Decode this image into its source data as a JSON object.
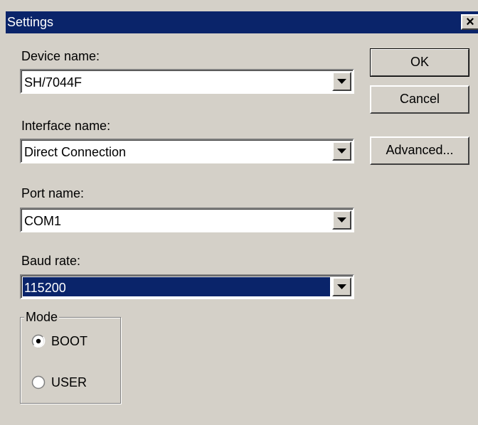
{
  "window": {
    "title": "Settings",
    "close_glyph": "×"
  },
  "fields": {
    "device": {
      "label": "Device name:",
      "value": "SH/7044F"
    },
    "interface": {
      "label": "Interface name:",
      "value": "Direct Connection"
    },
    "port": {
      "label": "Port name:",
      "value": "COM1"
    },
    "baud": {
      "label": "Baud rate:",
      "value": "115200"
    }
  },
  "buttons": {
    "ok": "OK",
    "cancel": "Cancel",
    "advanced": "Advanced..."
  },
  "mode": {
    "legend": "Mode",
    "options": [
      {
        "label": "BOOT",
        "selected": true
      },
      {
        "label": "USER",
        "selected": false
      }
    ]
  },
  "colors": {
    "face": "#d4d0c8",
    "titlebar": "#0a246a",
    "selection": "#0a246a"
  }
}
